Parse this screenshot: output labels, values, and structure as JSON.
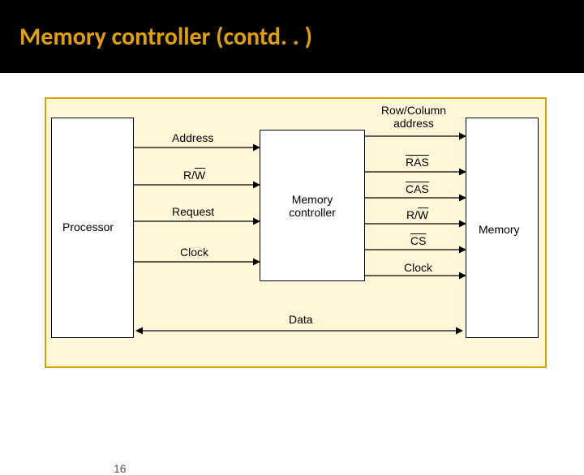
{
  "title": "Memory controller (contd. . )",
  "blocks": {
    "processor": "Processor",
    "memctrl_l1": "Memory",
    "memctrl_l2": "controller",
    "memory": "Memory"
  },
  "signals_left": {
    "address": "Address",
    "rw_pre": "R/",
    "rw_ov": "W",
    "request": "Request",
    "clock": "Clock"
  },
  "signals_right": {
    "rowcol_l1": "Row/Column",
    "rowcol_l2": "address",
    "ras": "RAS",
    "cas": "CAS",
    "rw_pre": "R/",
    "rw_ov": "W",
    "cs": "CS",
    "clock": "Clock"
  },
  "data_bus": "Data",
  "page_number": "16",
  "chart_data": {
    "type": "diagram",
    "title": "Memory controller (contd. . )",
    "nodes": [
      {
        "id": "processor",
        "label": "Processor"
      },
      {
        "id": "memctrl",
        "label": "Memory controller"
      },
      {
        "id": "memory",
        "label": "Memory"
      }
    ],
    "edges": [
      {
        "from": "processor",
        "to": "memctrl",
        "label": "Address",
        "direction": "forward"
      },
      {
        "from": "processor",
        "to": "memctrl",
        "label": "R/W̅",
        "direction": "forward"
      },
      {
        "from": "processor",
        "to": "memctrl",
        "label": "Request",
        "direction": "forward"
      },
      {
        "from": "processor",
        "to": "memctrl",
        "label": "Clock",
        "direction": "forward"
      },
      {
        "from": "memctrl",
        "to": "memory",
        "label": "Row/Column address",
        "direction": "forward"
      },
      {
        "from": "memctrl",
        "to": "memory",
        "label": "R̅A̅S̅",
        "direction": "forward"
      },
      {
        "from": "memctrl",
        "to": "memory",
        "label": "C̅A̅S̅",
        "direction": "forward"
      },
      {
        "from": "memctrl",
        "to": "memory",
        "label": "R/W̅",
        "direction": "forward"
      },
      {
        "from": "memctrl",
        "to": "memory",
        "label": "C̅S̅",
        "direction": "forward"
      },
      {
        "from": "memctrl",
        "to": "memory",
        "label": "Clock",
        "direction": "forward"
      },
      {
        "from": "processor",
        "to": "memory",
        "label": "Data",
        "direction": "bidirectional"
      }
    ]
  }
}
